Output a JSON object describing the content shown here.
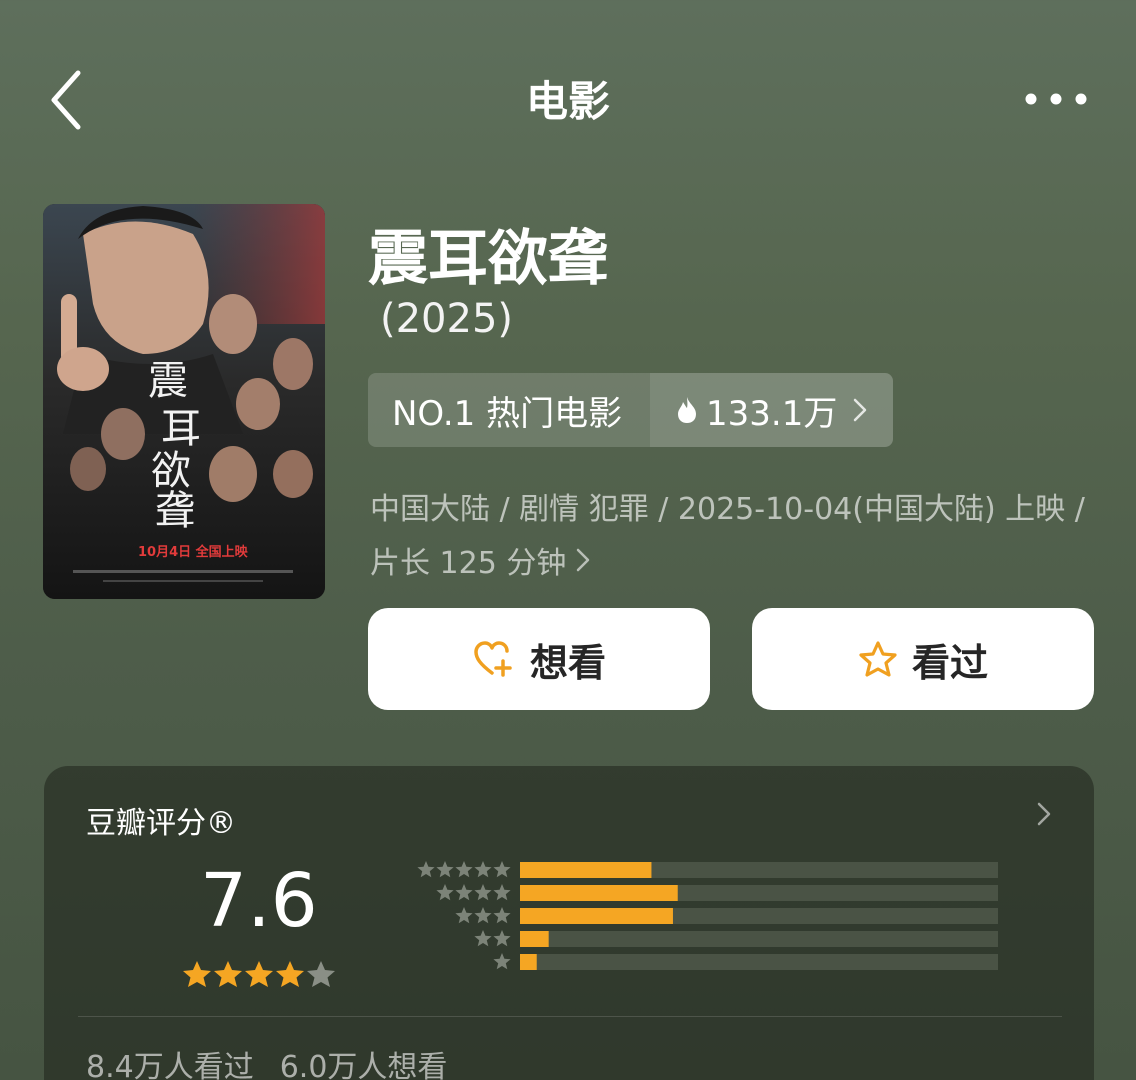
{
  "nav": {
    "title": "电影",
    "back_icon": "chevron-left-icon",
    "more_icon": "more-dots-icon"
  },
  "movie": {
    "title": "震耳欲聋",
    "year": "(2025)",
    "poster": {
      "title_text": "震耳欲聋",
      "release_text": "10月4日 全国上映"
    },
    "rank": {
      "label": "NO.1 热门电影",
      "heat": "133.1万",
      "heat_icon": "fire-icon"
    },
    "meta_line1": "中国大陆 / 剧情 犯罪 / 2025-10-04(中国大陆) 上映 /",
    "meta_line2": "片长 125 分钟"
  },
  "actions": {
    "want_label": "想看",
    "want_icon": "heart-plus-icon",
    "seen_label": "看过",
    "seen_icon": "star-outline-icon"
  },
  "rating": {
    "title": "豆瓣评分®",
    "score": "7.6",
    "stars_filled": 4,
    "stars_total": 5,
    "watched": "8.4万人看过",
    "wants": "6.0万人想看",
    "distribution": [
      {
        "stars": 5,
        "fraction": 0.275
      },
      {
        "stars": 4,
        "fraction": 0.33
      },
      {
        "stars": 3,
        "fraction": 0.32
      },
      {
        "stars": 2,
        "fraction": 0.06
      },
      {
        "stars": 1,
        "fraction": 0.035
      }
    ]
  },
  "colors": {
    "accent": "#f5a623",
    "bar_track": "#4a5345",
    "background": "#56664f"
  }
}
